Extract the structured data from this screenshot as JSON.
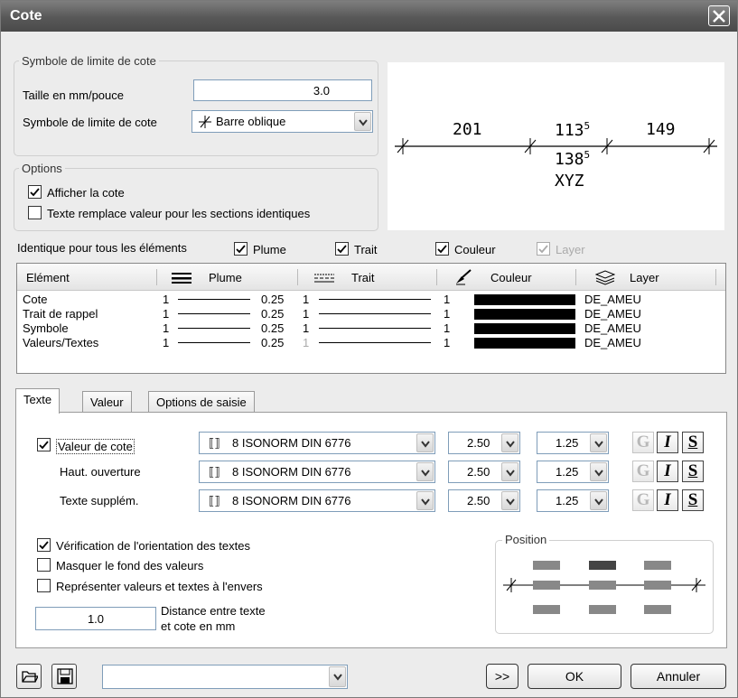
{
  "window": {
    "title": "Cote"
  },
  "symbol_group": {
    "title": "Symbole de limite de cote",
    "size_label": "Taille en mm/pouce",
    "size_value": "3.0",
    "symbol_label": "Symbole de limite de cote",
    "symbol_value": "Barre oblique"
  },
  "options_group": {
    "title": "Options",
    "show_dimension": {
      "label": "Afficher la cote",
      "checked": true
    },
    "text_replaces": {
      "label": "Texte remplace valeur pour les sections identiques",
      "checked": false
    }
  },
  "preview": {
    "v1": "201",
    "v2_main": "113",
    "v2_sup": "5",
    "v3": "149",
    "v4_main": "138",
    "v4_sup": "5",
    "text": "XYZ"
  },
  "identical": {
    "label": "Identique pour tous les éléments",
    "plume": {
      "label": "Plume",
      "checked": true
    },
    "trait": {
      "label": "Trait",
      "checked": true
    },
    "couleur": {
      "label": "Couleur",
      "checked": true
    },
    "layer": {
      "label": "Layer",
      "checked": true,
      "disabled": true
    }
  },
  "table": {
    "headers": {
      "element": "Elément",
      "plume": "Plume",
      "trait": "Trait",
      "couleur": "Couleur",
      "layer": "Layer"
    },
    "rows": [
      {
        "name": "Cote",
        "pen": "1",
        "thick": "0.25",
        "line": "1",
        "color": "1",
        "layer": "DE_AMEU"
      },
      {
        "name": "Trait de rappel",
        "pen": "1",
        "thick": "0.25",
        "line": "1",
        "color": "1",
        "layer": "DE_AMEU"
      },
      {
        "name": "Symbole",
        "pen": "1",
        "thick": "0.25",
        "line": "1",
        "color": "1",
        "layer": "DE_AMEU"
      },
      {
        "name": "Valeurs/Textes",
        "pen": "1",
        "thick": "0.25",
        "line": "1",
        "color": "1",
        "layer": "DE_AMEU"
      }
    ]
  },
  "tabs": [
    {
      "label": "Texte",
      "active": true
    },
    {
      "label": "Valeur",
      "active": false
    },
    {
      "label": "Options de saisie",
      "active": false
    }
  ],
  "text_tab": {
    "rows": [
      {
        "label": "Valeur de cote",
        "checkbox": true,
        "checked": true,
        "font": "8 ISONORM DIN 6776",
        "height": "2.50",
        "width": "1.25"
      },
      {
        "label": "Haut. ouverture",
        "checkbox": false,
        "font": "8 ISONORM DIN 6776",
        "height": "2.50",
        "width": "1.25"
      },
      {
        "label": "Texte supplém.",
        "checkbox": false,
        "font": "8 ISONORM DIN 6776",
        "height": "2.50",
        "width": "1.25"
      }
    ],
    "format_buttons": {
      "g": "G",
      "i": "I",
      "s": "S"
    },
    "verify_orientation": {
      "label": "Vérification de l'orientation des textes",
      "checked": true
    },
    "hide_background": {
      "label": "Masquer le fond des valeurs",
      "checked": false
    },
    "reverse": {
      "label": "Représenter valeurs et textes à l'envers",
      "checked": false
    },
    "distance_value": "1.0",
    "distance_label_1": "Distance entre texte",
    "distance_label_2": "et cote en mm",
    "position_title": "Position"
  },
  "footer": {
    "combo_value": "",
    "more_label": ">>",
    "ok_label": "OK",
    "cancel_label": "Annuler"
  },
  "colors": {
    "title_bar": "#5a5a5a",
    "selected_position": "#444444",
    "position_box": "#8c8c8c"
  }
}
